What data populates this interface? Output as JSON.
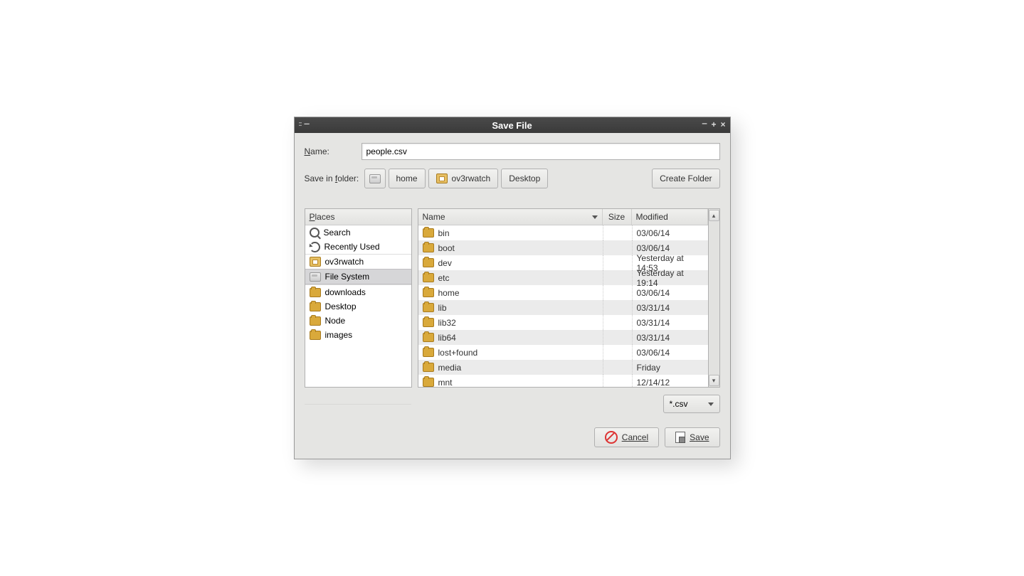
{
  "titlebar": {
    "title": "Save File"
  },
  "name_row": {
    "label": "Name:",
    "value": "people.csv"
  },
  "folder_row": {
    "label": "Save in folder:",
    "breadcrumbs": [
      "home",
      "ov3rwatch",
      "Desktop"
    ],
    "create_folder": "Create Folder"
  },
  "places": {
    "header": "Places",
    "search": "Search",
    "recent": "Recently Used",
    "items": [
      {
        "name": "ov3rwatch",
        "icon": "home"
      },
      {
        "name": "File System",
        "icon": "disk",
        "selected": true
      },
      {
        "name": "downloads",
        "icon": "folder",
        "sep": true
      },
      {
        "name": "Desktop",
        "icon": "folder"
      },
      {
        "name": "Node",
        "icon": "folder"
      },
      {
        "name": "images",
        "icon": "folder"
      }
    ]
  },
  "file_headers": {
    "name": "Name",
    "size": "Size",
    "modified": "Modified"
  },
  "files": [
    {
      "name": "bin",
      "modified": "03/06/14"
    },
    {
      "name": "boot",
      "modified": "03/06/14"
    },
    {
      "name": "dev",
      "modified": "Yesterday at 14:53"
    },
    {
      "name": "etc",
      "modified": "Yesterday at 19:14"
    },
    {
      "name": "home",
      "modified": "03/06/14"
    },
    {
      "name": "lib",
      "modified": "03/31/14"
    },
    {
      "name": "lib32",
      "modified": "03/31/14"
    },
    {
      "name": "lib64",
      "modified": "03/31/14"
    },
    {
      "name": "lost+found",
      "modified": "03/06/14"
    },
    {
      "name": "media",
      "modified": "Friday"
    },
    {
      "name": "mnt",
      "modified": "12/14/12"
    }
  ],
  "filetype": {
    "value": "*.csv"
  },
  "buttons": {
    "cancel": "Cancel",
    "save": "Save"
  }
}
